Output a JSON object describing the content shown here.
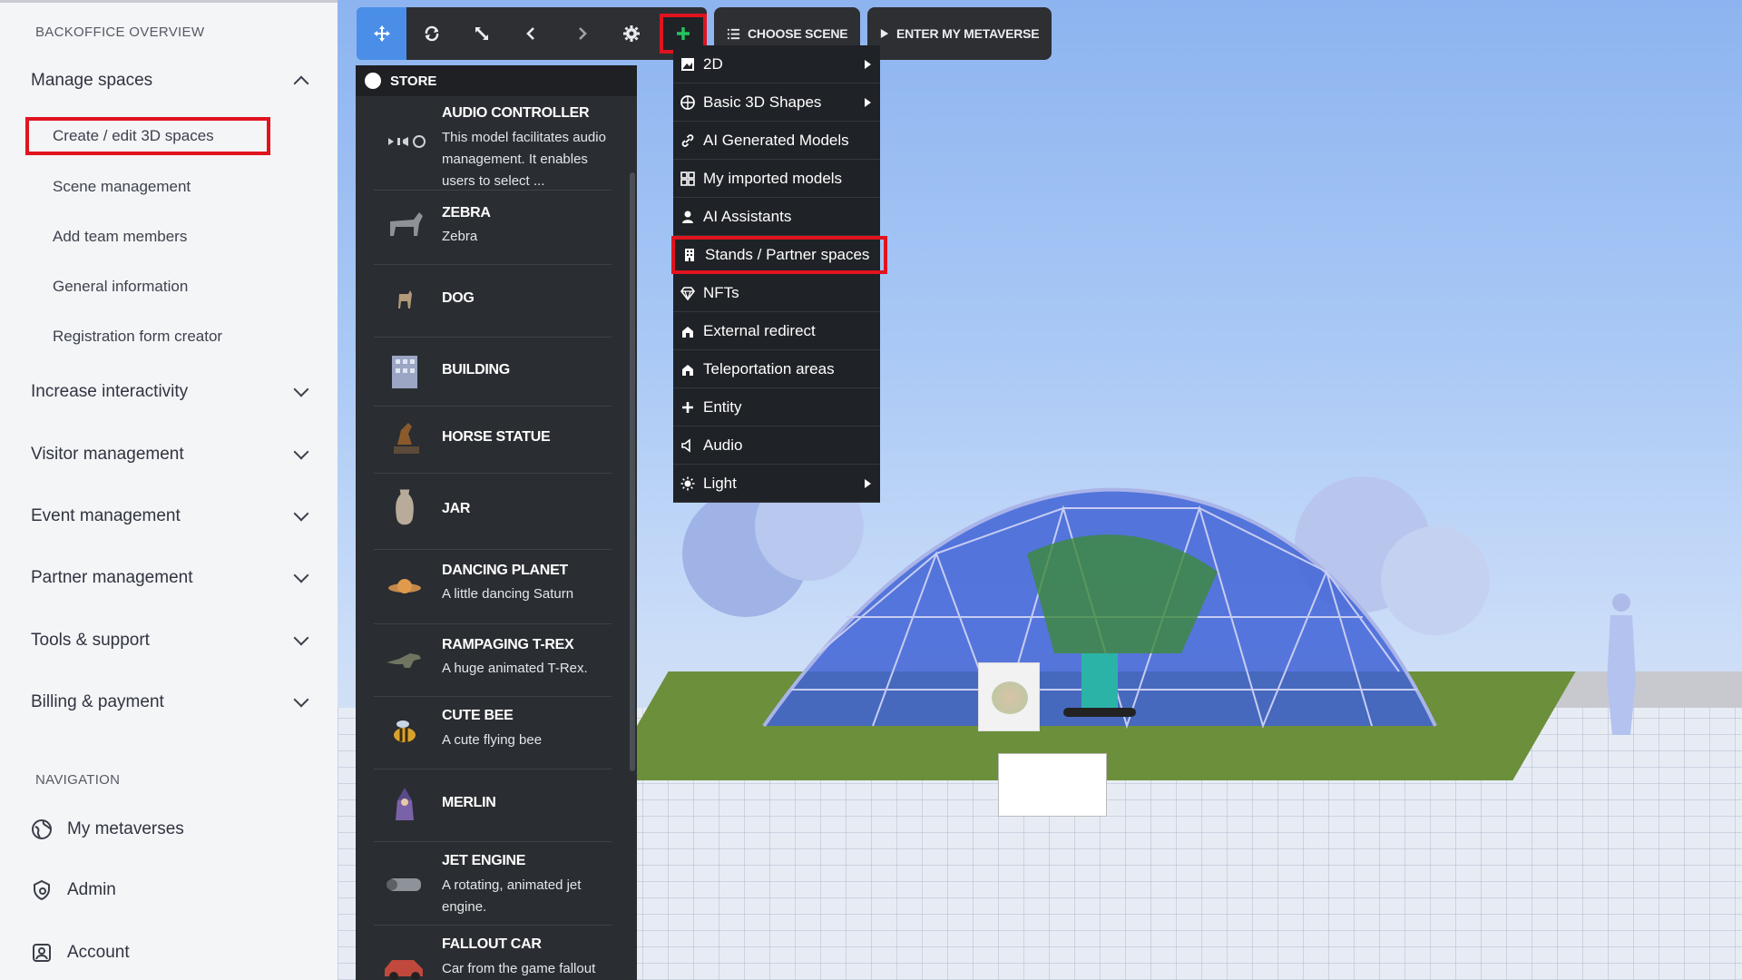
{
  "sidebar": {
    "section_title": "BACKOFFICE OVERVIEW",
    "manage_spaces": {
      "label": "Manage spaces",
      "items": [
        "Create / edit 3D spaces",
        "Scene management",
        "Add team members",
        "General information",
        "Registration form creator"
      ]
    },
    "groups": [
      "Increase interactivity",
      "Visitor management",
      "Event management",
      "Partner management",
      "Tools & support",
      "Billing & payment"
    ],
    "nav_title": "NAVIGATION",
    "nav": [
      {
        "label": "My metaverses",
        "icon": "globe-icon"
      },
      {
        "label": "Admin",
        "icon": "admin-icon"
      },
      {
        "label": "Account",
        "icon": "account-icon"
      }
    ]
  },
  "toolbar": {
    "choose_scene": "CHOOSE SCENE",
    "enter_metaverse": "ENTER MY METAVERSE",
    "accent": "#4a8ee8",
    "add_color": "#22c55e"
  },
  "store": {
    "title": "STORE",
    "items": [
      {
        "title": "AUDIO CONTROLLER",
        "desc": "This model facilitates audio management. It enables users to select ..."
      },
      {
        "title": "ZEBRA",
        "desc": "Zebra"
      },
      {
        "title": "DOG",
        "desc": ""
      },
      {
        "title": "BUILDING",
        "desc": ""
      },
      {
        "title": "HORSE STATUE",
        "desc": ""
      },
      {
        "title": "JAR",
        "desc": ""
      },
      {
        "title": "DANCING PLANET",
        "desc": "A little dancing Saturn"
      },
      {
        "title": "RAMPAGING T-REX",
        "desc": "A huge animated T-Rex."
      },
      {
        "title": "CUTE BEE",
        "desc": "A cute flying bee"
      },
      {
        "title": "MERLIN",
        "desc": ""
      },
      {
        "title": "JET ENGINE",
        "desc": "A rotating, animated jet engine."
      },
      {
        "title": "FALLOUT CAR",
        "desc": "Car from the game fallout"
      }
    ]
  },
  "add_menu": {
    "items": [
      {
        "label": "2D",
        "submenu": true
      },
      {
        "label": "Basic 3D Shapes",
        "submenu": true
      },
      {
        "label": "AI Generated Models",
        "submenu": false
      },
      {
        "label": "My imported models",
        "submenu": false
      },
      {
        "label": "AI Assistants",
        "submenu": false
      },
      {
        "label": "Stands / Partner spaces",
        "submenu": false
      },
      {
        "label": "NFTs",
        "submenu": false
      },
      {
        "label": "External redirect",
        "submenu": false
      },
      {
        "label": "Teleportation areas",
        "submenu": false
      },
      {
        "label": "Entity",
        "submenu": false
      },
      {
        "label": "Audio",
        "submenu": false
      },
      {
        "label": "Light",
        "submenu": true
      }
    ]
  }
}
